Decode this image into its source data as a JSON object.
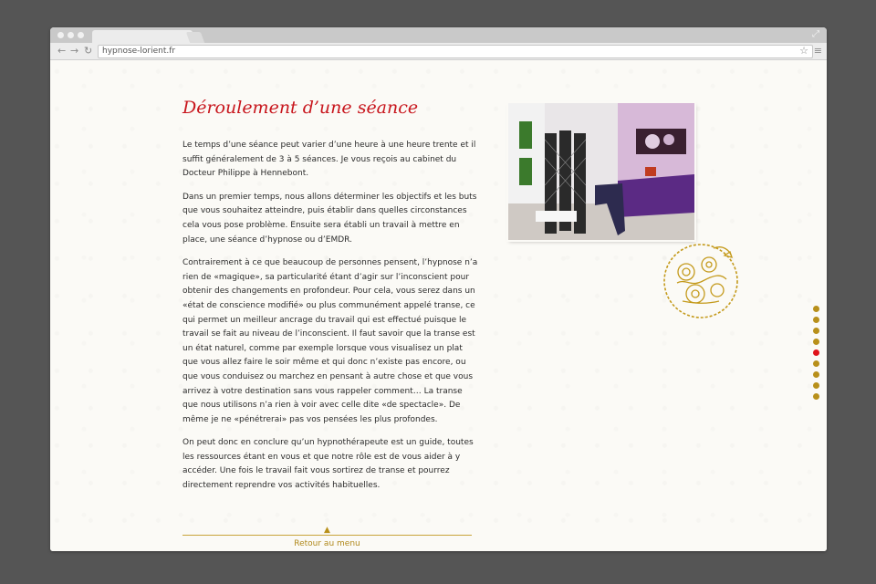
{
  "browser": {
    "url": "hypnose-lorient.fr"
  },
  "article": {
    "title": "Déroulement d’une séance",
    "paragraphs": [
      "Le temps d’une séance peut varier d’une heure à une heure trente et il suffit généralement de 3 à 5 séances. Je vous reçois au cabinet du Docteur Philippe à Hennebont.",
      "Dans un premier temps, nous allons déterminer les objectifs et les buts que vous souhaitez atteindre, puis établir dans quelles circonstances cela vous pose problème. Ensuite sera établi un travail à mettre en place, une séance d’hypnose ou d’EMDR.",
      "Contrairement à ce que beaucoup de personnes pensent, l’hypnose n’a rien de «magique», sa particularité étant d’agir sur l’inconscient pour obtenir des changements en profondeur. Pour cela, vous serez dans un «état de conscience modifié» ou plus communément appelé transe, ce qui permet un meilleur ancrage du travail qui est effectué puisque le travail se fait au niveau de l’inconscient. Il faut  savoir que la transe est un état naturel, comme par exemple lorsque vous visualisez un plat que vous allez faire le soir même et qui donc n’existe pas encore, ou que vous conduisez ou marchez en pensant à autre chose et que vous arrivez à votre destination sans vous rappeler comment… La transe que nous utilisons n’a rien à voir avec celle dite «de spectacle». De même je ne «pénétrerai» pas vos pensées les plus profondes.",
      "On peut donc en conclure qu’un hypnothérapeute est un guide, toutes les ressources étant en vous et que notre rôle est de vous aider à y accéder. Une fois le travail fait vous sortirez de transe et pourrez directement reprendre vos activités habituelles."
    ]
  },
  "menu": {
    "back_label": "Retour au menu",
    "up_arrow": "▲",
    "down_arrow": "▼"
  },
  "section_nav": {
    "count": 9,
    "active_index": 4
  },
  "colors": {
    "accent_red": "#c8161d",
    "gold": "#b8901a",
    "background": "#fbfaf6"
  }
}
